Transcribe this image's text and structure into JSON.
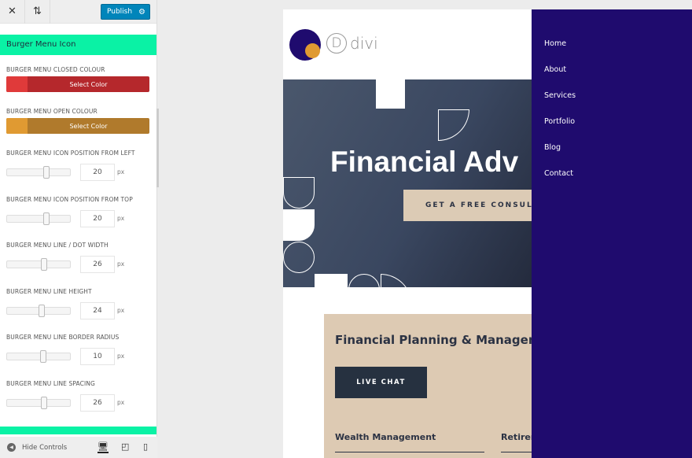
{
  "toolbar": {
    "close_icon": "close-icon",
    "sort_icon": "reorder-icon",
    "publish_label": "Publish",
    "settings_icon": "gear-icon"
  },
  "section": {
    "title": "Burger Menu Icon"
  },
  "colors": [
    {
      "label": "BURGER MENU CLOSED COLOUR",
      "button": "Select Color",
      "swatch": "#e03a3a",
      "color": "#b5282c"
    },
    {
      "label": "BURGER MENU OPEN COLOUR",
      "button": "Select Color",
      "swatch": "#e09a32",
      "color": "#b07a2c"
    }
  ],
  "sliders": [
    {
      "label": "BURGER MENU ICON POSITION FROM LEFT",
      "value": "20",
      "unit": "px"
    },
    {
      "label": "BURGER MENU ICON POSITION FROM TOP",
      "value": "20",
      "unit": "px"
    },
    {
      "label": "BURGER MENU LINE / DOT WIDTH",
      "value": "26",
      "unit": "px"
    },
    {
      "label": "BURGER MENU LINE HEIGHT",
      "value": "24",
      "unit": "px"
    },
    {
      "label": "BURGER MENU LINE BORDER RADIUS",
      "value": "10",
      "unit": "px"
    },
    {
      "label": "BURGER MENU LINE SPACING",
      "value": "26",
      "unit": "px"
    }
  ],
  "bottom": {
    "hide_label": "Hide Controls",
    "devices": [
      "desktop-icon",
      "tablet-icon",
      "phone-icon"
    ]
  },
  "preview": {
    "logo_text": "divi",
    "logo_letter": "D",
    "hero_title": "Financial Adv",
    "cta": "GET A FREE CONSULTAT",
    "card_title": "Financial Planning & Manageme",
    "chat": "LIVE CHAT",
    "sub1": "Wealth Management",
    "sub2": "Retirem",
    "menu": [
      "Home",
      "About",
      "Services",
      "Portfolio",
      "Blog",
      "Contact"
    ],
    "menu_color": "#1f0b6e",
    "accent": "#0af2a5"
  }
}
